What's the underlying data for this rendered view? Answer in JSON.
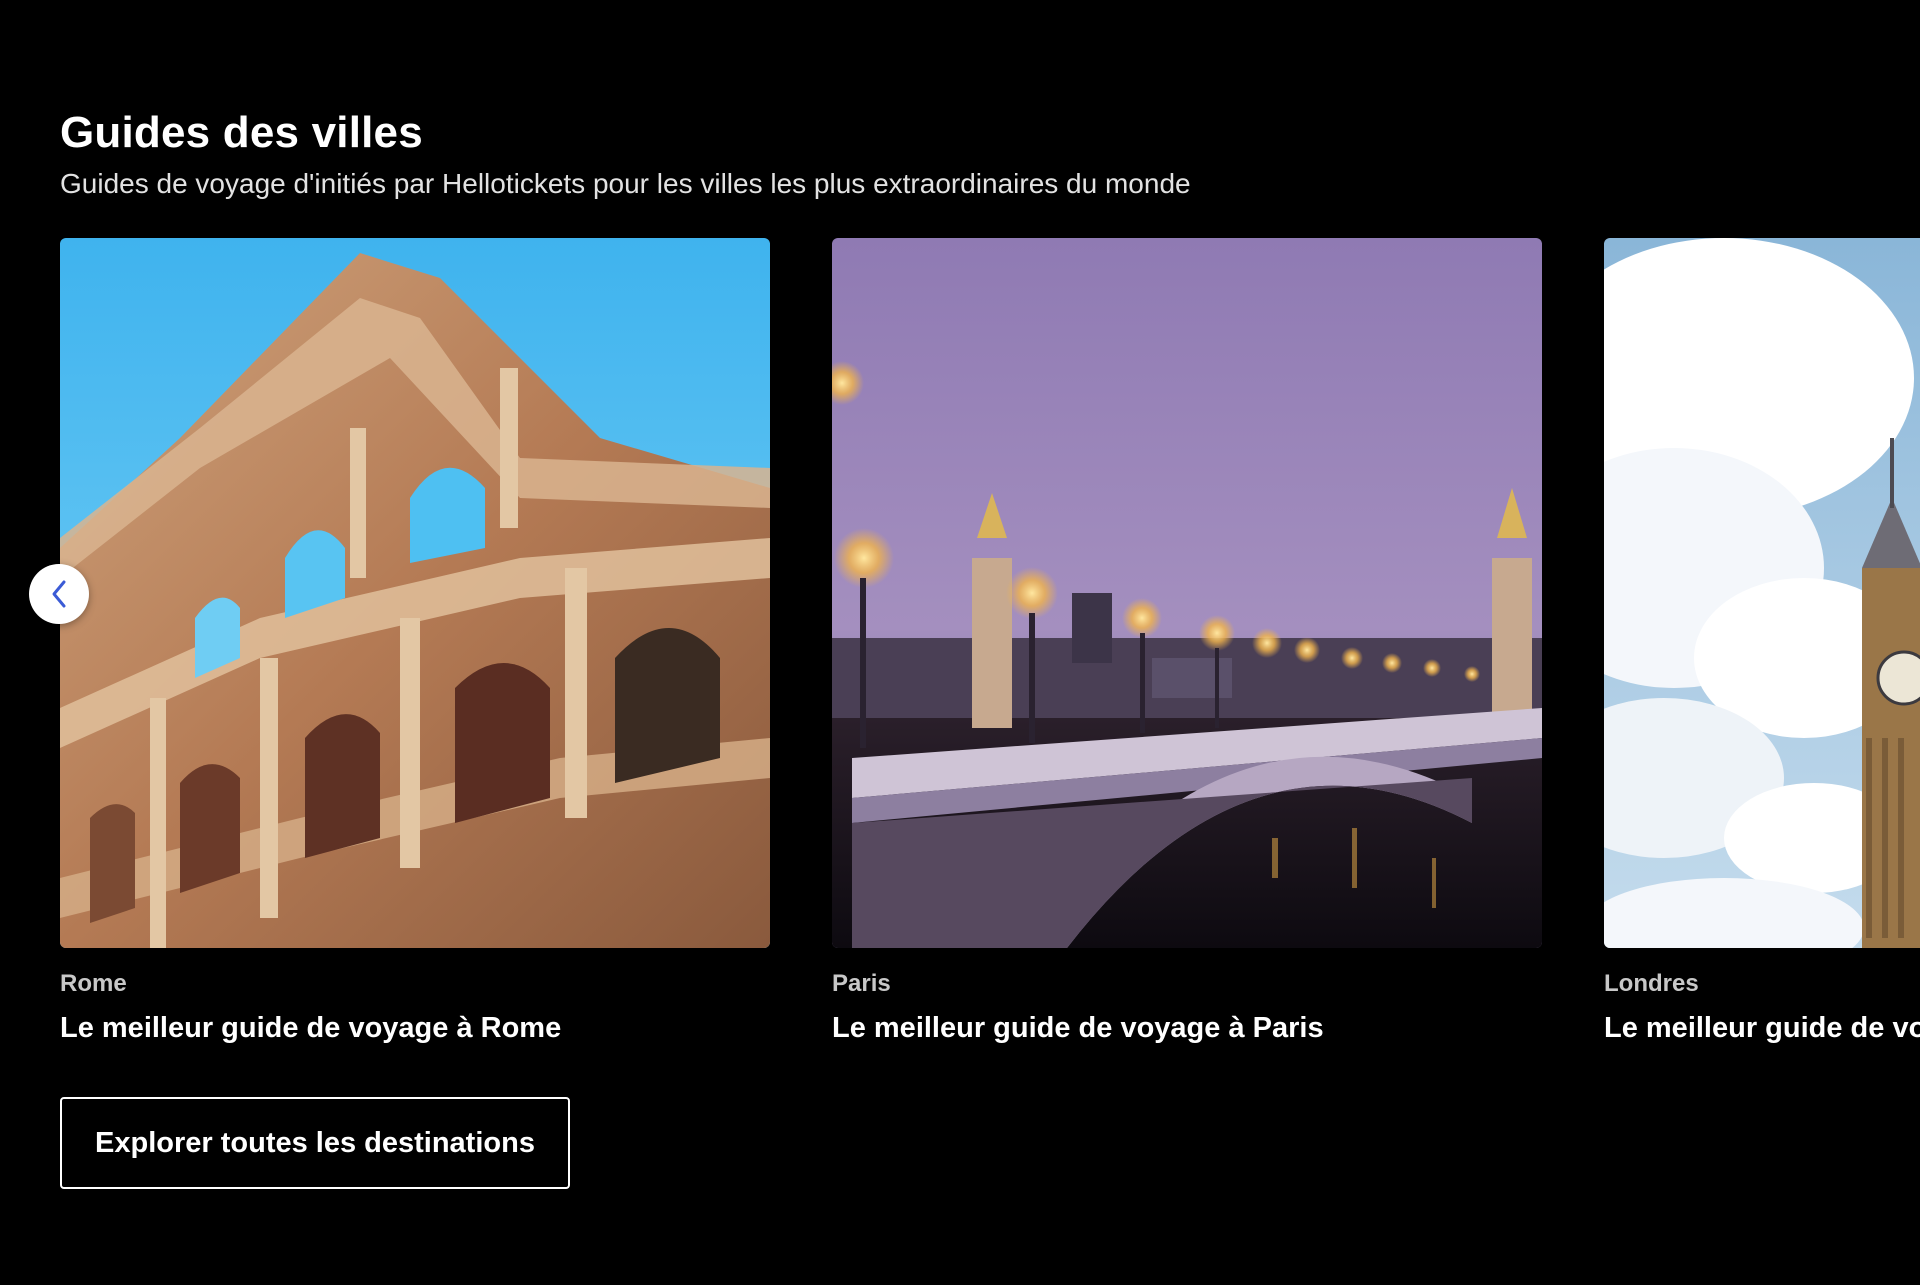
{
  "section": {
    "title": "Guides des villes",
    "subtitle": "Guides de voyage d'initiés par Hellotickets pour les villes les plus extraordinaires du monde"
  },
  "carousel": {
    "prev_icon": "chevron-left-icon",
    "cards": [
      {
        "city": "Rome",
        "title": "Le meilleur guide de voyage à Rome",
        "image": "colosseum-photo"
      },
      {
        "city": "Paris",
        "title": "Le meilleur guide de voyage à Paris",
        "image": "pont-alexandre-iii-photo"
      },
      {
        "city": "Londres",
        "title": "Le meilleur guide de voyage à Londres",
        "image": "big-ben-photo"
      }
    ]
  },
  "cta": {
    "label": "Explorer toutes les destinations"
  },
  "colors": {
    "background": "#000000",
    "text": "#ffffff",
    "muted_text": "#c8c8c8",
    "chevron": "#3b5bd6"
  }
}
